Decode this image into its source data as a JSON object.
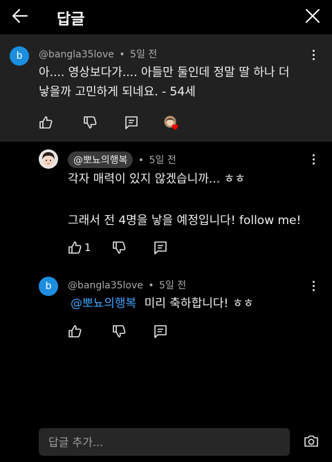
{
  "header": {
    "title": "답글"
  },
  "parent_comment": {
    "avatar_letter": "b",
    "author": "@bangla35love",
    "separator": "•",
    "time": "5일 전",
    "text_line1": "아.... 영상보다가.... 아들만 둘인데 정말 딸 하나 더",
    "text_line2": "낳을까 고민하게 되네요. - 54세"
  },
  "reply1": {
    "author": "@뽀뇨의행복",
    "separator": "•",
    "time": "5일 전",
    "text_line1": "각자 매력이 있지 않겠습니까... ㅎㅎ",
    "text_line2": "그래서 전 4명을 낳을 예정입니다! follow me!",
    "like_count": "1"
  },
  "reply2": {
    "avatar_letter": "b",
    "author": "@bangla35love",
    "separator": "•",
    "time": "5일 전",
    "mention": "@뽀뇨의행복",
    "text": "미리 축하합니다! ㅎㅎ"
  },
  "composer": {
    "placeholder": "답글 추가..."
  },
  "colors": {
    "background": "#000000",
    "parent_bg": "#212121",
    "avatar_blue": "#1c8ee0",
    "mention_blue": "#3ea6ff",
    "heart_red": "#ff0000"
  }
}
